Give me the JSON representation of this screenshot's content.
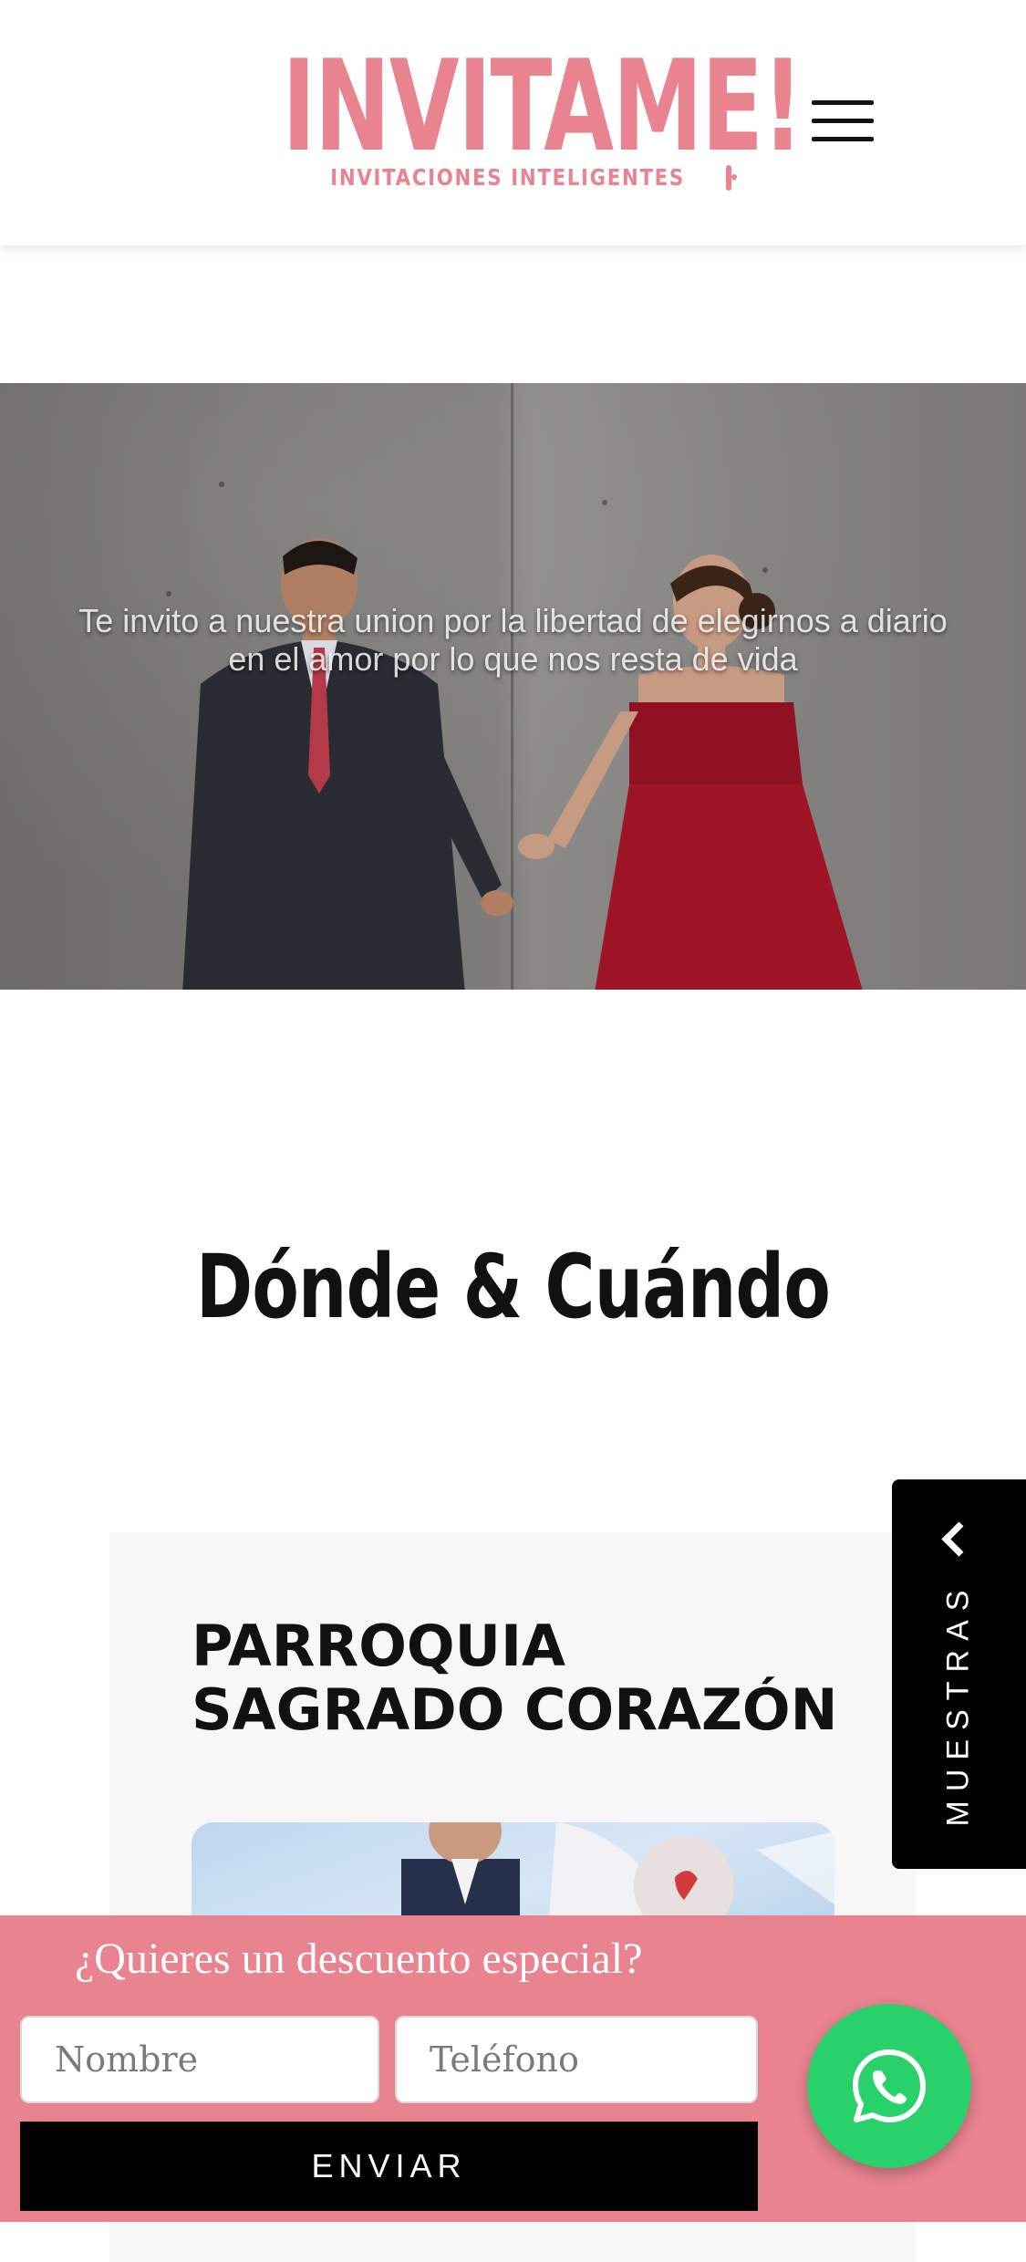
{
  "header": {
    "logo_title": "INVITAME!",
    "logo_subtitle": "INVITACIONES INTELIGENTES",
    "menu_icon": "hamburger-menu-icon"
  },
  "hero": {
    "text": "Te invito a nuestra union por la libertad de elegirnos a diario en el amor por lo que nos resta de vida"
  },
  "section": {
    "title": "Dónde & Cuándo"
  },
  "card": {
    "title": "PARROQUIA\nSAGRADO CORAZÓN"
  },
  "side_tab": {
    "label": "MUESTRAS",
    "icon": "chevron-left-icon"
  },
  "promo": {
    "title": "¿Quieres un descuento especial?",
    "name_placeholder": "Nombre",
    "phone_placeholder": "Teléfono",
    "submit_label": "ENVIAR"
  },
  "whatsapp": {
    "icon": "whatsapp-icon"
  },
  "colors": {
    "brand_pink": "#e8838f",
    "whatsapp_green": "#29d16a",
    "dark": "#000000"
  }
}
